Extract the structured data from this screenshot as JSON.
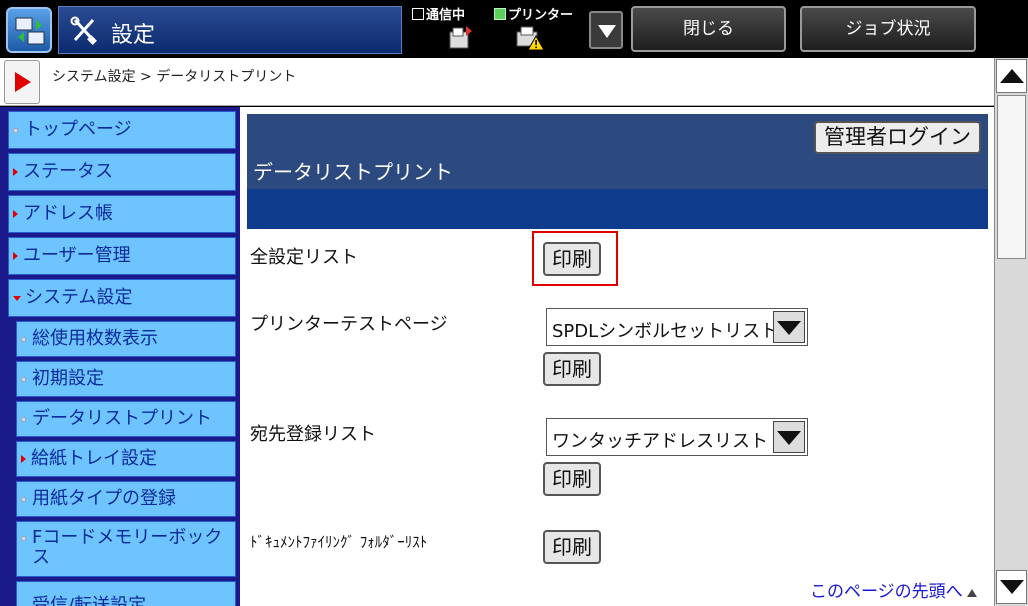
{
  "header": {
    "title": "設定",
    "status_comm": "通信中",
    "status_printer": "プリンター",
    "close_label": "閉じる",
    "job_status_label": "ジョブ状況"
  },
  "breadcrumb": "システム設定 > データリストプリント",
  "sidebar": {
    "items": [
      {
        "label": "トップページ"
      },
      {
        "label": "ステータス"
      },
      {
        "label": "アドレス帳"
      },
      {
        "label": "ユーザー管理"
      },
      {
        "label": "システム設定"
      },
      {
        "label": "総使用枚数表示"
      },
      {
        "label": "初期設定"
      },
      {
        "label": "データリストプリント"
      },
      {
        "label": "給紙トレイ設定"
      },
      {
        "label": "用紙タイプの登録"
      },
      {
        "label": "Fコードメモリーボックス"
      },
      {
        "label": "受信/転送設定"
      }
    ]
  },
  "main": {
    "admin_login_label": "管理者ログイン",
    "page_title": "データリストプリント",
    "rows": [
      {
        "label": "全設定リスト",
        "print_label": "印刷"
      },
      {
        "label": "プリンターテストページ",
        "select_value": "SPDLシンボルセットリスト",
        "print_label": "印刷"
      },
      {
        "label": "宛先登録リスト",
        "select_value": "ワンタッチアドレスリスト",
        "print_label": "印刷"
      },
      {
        "label": "ﾄﾞｷｭﾒﾝﾄﾌｧｲﾘﾝｸﾞ ﾌｫﾙﾀﾞｰﾘｽﾄ",
        "print_label": "印刷"
      }
    ],
    "page_top_link": "このページの先頭へ"
  },
  "colors": {
    "sidebar_bg": "#6ec4ff",
    "header_band": "#2d4a80",
    "highlight": "#e00000"
  }
}
